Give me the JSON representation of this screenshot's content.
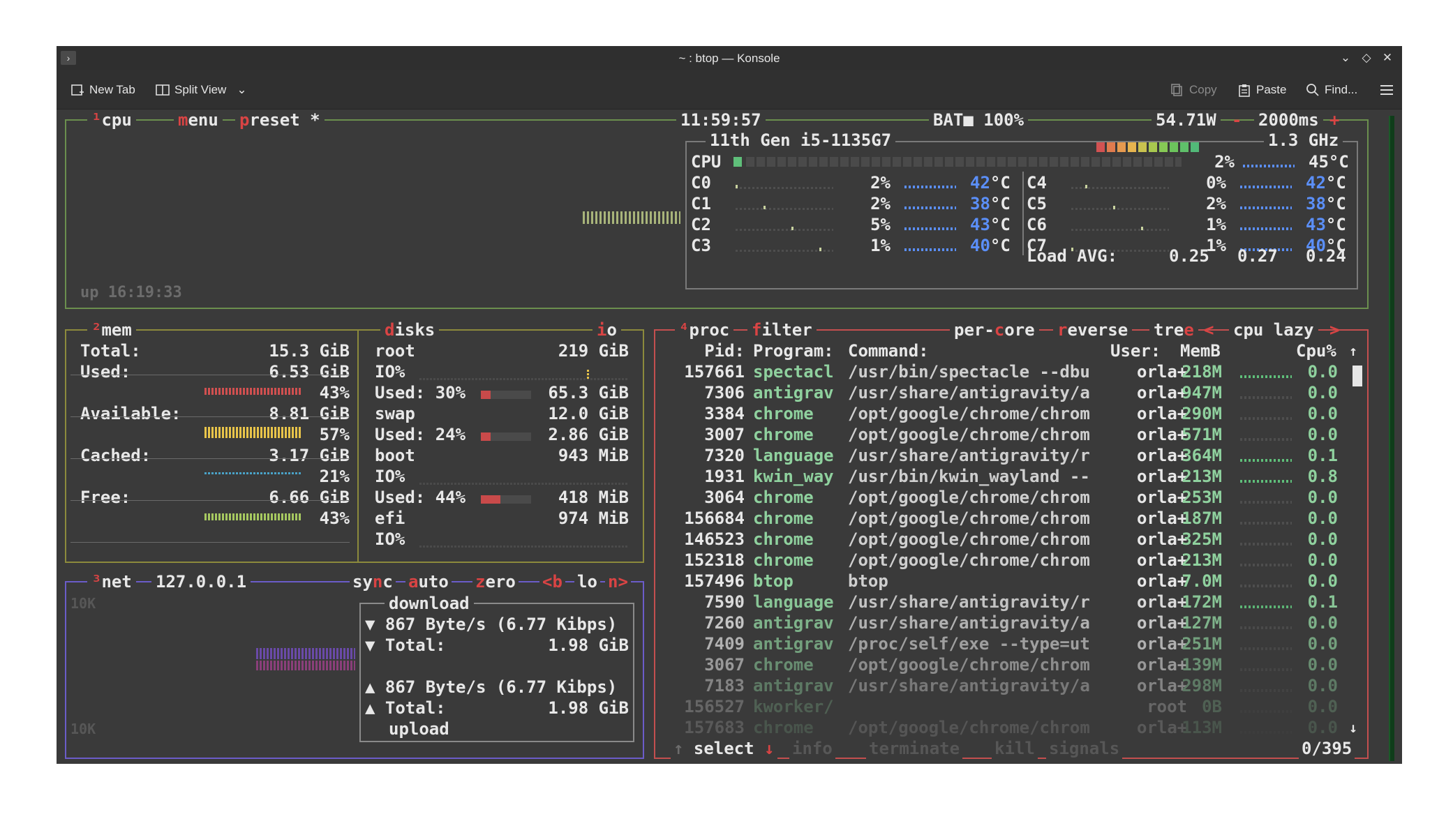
{
  "window": {
    "title": "~ : btop — Konsole",
    "toolbar": {
      "new_tab": "New Tab",
      "split_view": "Split View",
      "copy": "Copy",
      "paste": "Paste",
      "find": "Find..."
    }
  },
  "colors": {
    "cpu_box": "#6b8f4e",
    "mem_box": "#8c8a3c",
    "net_box": "#6b5cc9",
    "proc_box": "#c44f4f",
    "cpu_inner": "#8a8a8a",
    "accent_red": "#d94444",
    "temp_blue": "#5b8ff9",
    "proc_green": "#8fd19e"
  },
  "cpu": {
    "header": {
      "cpu": "cpu",
      "menu": "menu",
      "preset": "preset *",
      "clock": "11:59:57",
      "battery_label": "BAT",
      "battery_pct": "100%",
      "power": "54.71W",
      "minus": "-",
      "interval": "2000ms",
      "plus": "+"
    },
    "uptime": "up 16:19:33",
    "model": "11th Gen i5-1135G7",
    "freq": "1.3 GHz",
    "total": {
      "label": "CPU",
      "pct": "2%",
      "temp": "45°C"
    },
    "cores": [
      {
        "label": "C0",
        "pct": "2%",
        "temp": "42°C"
      },
      {
        "label": "C1",
        "pct": "2%",
        "temp": "38°C"
      },
      {
        "label": "C2",
        "pct": "5%",
        "temp": "43°C"
      },
      {
        "label": "C3",
        "pct": "1%",
        "temp": "40°C"
      },
      {
        "label": "C4",
        "pct": "0%",
        "temp": "42°C"
      },
      {
        "label": "C5",
        "pct": "2%",
        "temp": "38°C"
      },
      {
        "label": "C6",
        "pct": "1%",
        "temp": "43°C"
      },
      {
        "label": "C7",
        "pct": "1%",
        "temp": "40°C"
      }
    ],
    "load_label": "Load AVG:",
    "load": [
      "0.25",
      "0.27",
      "0.24"
    ]
  },
  "mem": {
    "title": "mem",
    "total_label": "Total:",
    "total": "15.3 GiB",
    "used_label": "Used:",
    "used": "6.53 GiB",
    "used_pct": "43%",
    "avail_label": "Available:",
    "avail": "8.81 GiB",
    "avail_pct": "57%",
    "cached_label": "Cached:",
    "cached": "3.17 GiB",
    "cached_pct": "21%",
    "free_label": "Free:",
    "free": "6.66 GiB",
    "free_pct": "43%"
  },
  "disks": {
    "title": "disks",
    "io": "io",
    "entries": [
      {
        "name": "root",
        "size": "219 GiB",
        "io": "IO%",
        "used_label": "Used: 30%",
        "used": "65.3 GiB"
      },
      {
        "name": "swap",
        "size": "12.0 GiB",
        "used_label": "Used: 24%",
        "used": "2.86 GiB"
      },
      {
        "name": "boot",
        "size": "943 MiB",
        "io": "IO%",
        "used_label": "Used: 44%",
        "used": "418 MiB"
      },
      {
        "name": "efi",
        "size": "974 MiB",
        "io": "IO%"
      }
    ]
  },
  "net": {
    "title": "net",
    "addr": "127.0.0.1",
    "sync": "sync",
    "auto": "auto",
    "zero": "zero",
    "b": "<b",
    "iface": "lo",
    "n": "n>",
    "scale_top": "10K",
    "scale_bottom": "10K",
    "download": "download",
    "dl_rate": "▼ 867 Byte/s (6.77 Kibps)",
    "dl_total_label": "▼ Total:",
    "dl_total": "1.98 GiB",
    "ul_rate": "▲ 867 Byte/s (6.77 Kibps)",
    "ul_total_label": "▲ Total:",
    "ul_total": "1.98 GiB",
    "upload": "upload"
  },
  "proc": {
    "title": "proc",
    "filter": "filter",
    "per_core": "per-core",
    "reverse": "reverse",
    "tree": "tree",
    "sort_left": "<",
    "sort": "cpu lazy",
    "sort_right": ">",
    "columns": {
      "pid": "Pid:",
      "program": "Program:",
      "command": "Command:",
      "user": "User:",
      "mem": "MemB",
      "cpu": "Cpu%"
    },
    "rows": [
      {
        "pid": "157661",
        "program": "spectacl",
        "command": "/usr/bin/spectacle --dbu",
        "user": "orla+",
        "mem": "218M",
        "cpu": "0.0"
      },
      {
        "pid": "7306",
        "program": "antigrav",
        "command": "/usr/share/antigravity/a",
        "user": "orla+",
        "mem": "947M",
        "cpu": "0.0"
      },
      {
        "pid": "3384",
        "program": "chrome",
        "command": "/opt/google/chrome/chrom",
        "user": "orla+",
        "mem": "290M",
        "cpu": "0.0"
      },
      {
        "pid": "3007",
        "program": "chrome",
        "command": "/opt/google/chrome/chrom",
        "user": "orla+",
        "mem": "571M",
        "cpu": "0.0"
      },
      {
        "pid": "7320",
        "program": "language",
        "command": "/usr/share/antigravity/r",
        "user": "orla+",
        "mem": "364M",
        "cpu": "0.1"
      },
      {
        "pid": "1931",
        "program": "kwin_way",
        "command": "/usr/bin/kwin_wayland --",
        "user": "orla+",
        "mem": "213M",
        "cpu": "0.8"
      },
      {
        "pid": "3064",
        "program": "chrome",
        "command": "/opt/google/chrome/chrom",
        "user": "orla+",
        "mem": "253M",
        "cpu": "0.0"
      },
      {
        "pid": "156684",
        "program": "chrome",
        "command": "/opt/google/chrome/chrom",
        "user": "orla+",
        "mem": "187M",
        "cpu": "0.0"
      },
      {
        "pid": "146523",
        "program": "chrome",
        "command": "/opt/google/chrome/chrom",
        "user": "orla+",
        "mem": "325M",
        "cpu": "0.0"
      },
      {
        "pid": "152318",
        "program": "chrome",
        "command": "/opt/google/chrome/chrom",
        "user": "orla+",
        "mem": "213M",
        "cpu": "0.0"
      },
      {
        "pid": "157496",
        "program": "btop",
        "command": "btop",
        "user": "orla+",
        "mem": "7.0M",
        "cpu": "0.0"
      },
      {
        "pid": "7590",
        "program": "language",
        "command": "/usr/share/antigravity/r",
        "user": "orla+",
        "mem": "172M",
        "cpu": "0.1"
      },
      {
        "pid": "7260",
        "program": "antigrav",
        "command": "/usr/share/antigravity/a",
        "user": "orla+",
        "mem": "127M",
        "cpu": "0.0"
      },
      {
        "pid": "7409",
        "program": "antigrav",
        "command": "/proc/self/exe --type=ut",
        "user": "orla+",
        "mem": "251M",
        "cpu": "0.0"
      },
      {
        "pid": "3067",
        "program": "chrome",
        "command": "/opt/google/chrome/chrom",
        "user": "orla+",
        "mem": "139M",
        "cpu": "0.0"
      },
      {
        "pid": "7183",
        "program": "antigrav",
        "command": "/usr/share/antigravity/a",
        "user": "orla+",
        "mem": "298M",
        "cpu": "0.0"
      },
      {
        "pid": "156527",
        "program": "kworker/",
        "command": "",
        "user": "root",
        "mem": "0B",
        "cpu": "0.0"
      },
      {
        "pid": "157683",
        "program": "chrome",
        "command": "/opt/google/chrome/chrom",
        "user": "orla+",
        "mem": "113M",
        "cpu": "0.0"
      }
    ],
    "footer": {
      "select": "select",
      "info": "info",
      "terminate": "terminate",
      "kill": "kill",
      "signals": "signals",
      "count": "0/395"
    }
  }
}
